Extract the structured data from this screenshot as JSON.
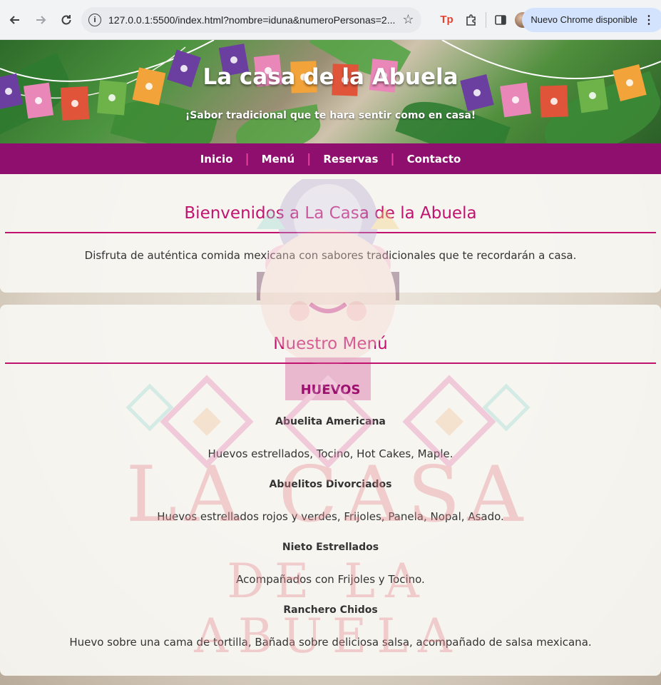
{
  "browser": {
    "url": "127.0.0.1:5500/index.html?nombre=iduna&numeroPersonas=2...",
    "ext_tp": "Tp",
    "update_label": "Nuevo Chrome disponible",
    "menu_dots": "⋮",
    "icons": [
      "back-icon",
      "forward-icon",
      "reload-icon",
      "info-icon",
      "star-icon",
      "tp-extension-icon",
      "puzzle-icon",
      "side-panel-icon",
      "avatar"
    ]
  },
  "hero": {
    "title": "La casa de la Abuela",
    "subtitle": "¡Sabor tradicional que te hara sentir como en casa!"
  },
  "nav": {
    "items": [
      "Inicio",
      "Menú",
      "Reservas",
      "Contacto"
    ],
    "separator": "|"
  },
  "welcome": {
    "heading": "Bienvenidos a La Casa de la Abuela",
    "text": "Disfruta de auténtica comida mexicana con sabores tradicionales que te recordarán a casa."
  },
  "menu": {
    "heading": "Nuestro Menú",
    "category": "HUEVOS",
    "dishes": [
      {
        "name": "Abuelita Americana",
        "desc": "Huevos estrellados, Tocino, Hot Cakes, Maple."
      },
      {
        "name": "Abuelitos Divorciados",
        "desc": "Huevos estrellados rojos y verdes, Frijoles, Panela, Nopal, Asado."
      },
      {
        "name": "Nieto Estrellados",
        "desc": "Acompañados con Frijoles y Tocino."
      },
      {
        "name": "Ranchero Chidos",
        "desc": "Huevo sobre una cama de tortilla, Bañada sobre deliciosa salsa, acompañado de salsa mexicana."
      }
    ]
  },
  "watermark": {
    "line1": "LA CASA",
    "line2": "DE LA ABUELA"
  },
  "colors": {
    "nav_bg": "#8e0f6e",
    "heading": "#c2126f",
    "category": "#8e0f6e",
    "separator": "#e8439c"
  }
}
